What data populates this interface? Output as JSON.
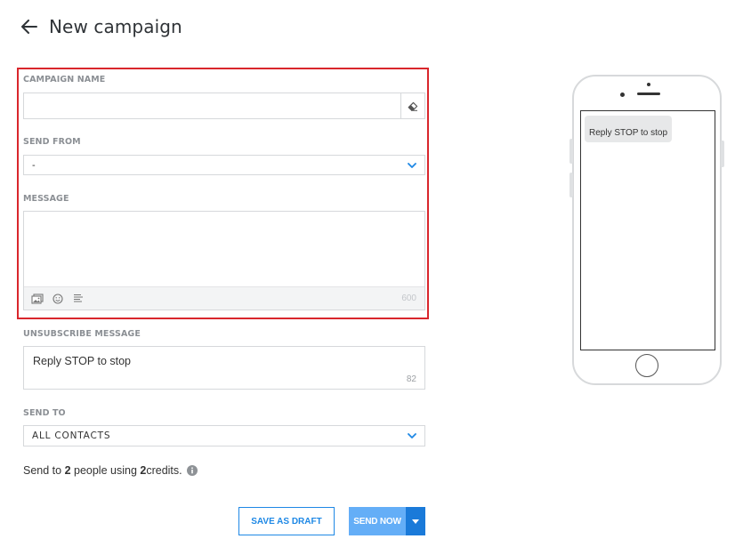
{
  "header": {
    "title": "New campaign"
  },
  "form": {
    "campaign_name": {
      "label": "CAMPAIGN NAME",
      "value": "",
      "placeholder": ""
    },
    "send_from": {
      "label": "SEND FROM",
      "selected": "-"
    },
    "message": {
      "label": "MESSAGE",
      "value": "",
      "char_count": "600"
    },
    "unsubscribe": {
      "label": "UNSUBSCRIBE MESSAGE",
      "text": "Reply STOP to stop",
      "char_count": "82"
    },
    "send_to": {
      "label": "SEND TO",
      "selected": "ALL CONTACTS"
    }
  },
  "summary": {
    "prefix": "Send to ",
    "people_count": "2",
    "middle": " people using ",
    "credits_count": "2",
    "suffix": " credits."
  },
  "buttons": {
    "save_draft": "SAVE AS DRAFT",
    "send_now": "SEND NOW"
  },
  "preview": {
    "bubble_text": "Reply STOP to stop"
  },
  "colors": {
    "accent": "#1e88e5",
    "highlight": "#d9262c"
  },
  "icons": {
    "back": "arrow-left-icon",
    "clear": "eraser-icon",
    "chevron": "chevron-down-icon",
    "image": "image-gallery-icon",
    "emoji": "smiley-icon",
    "template": "text-lines-icon",
    "info": "info-icon"
  }
}
